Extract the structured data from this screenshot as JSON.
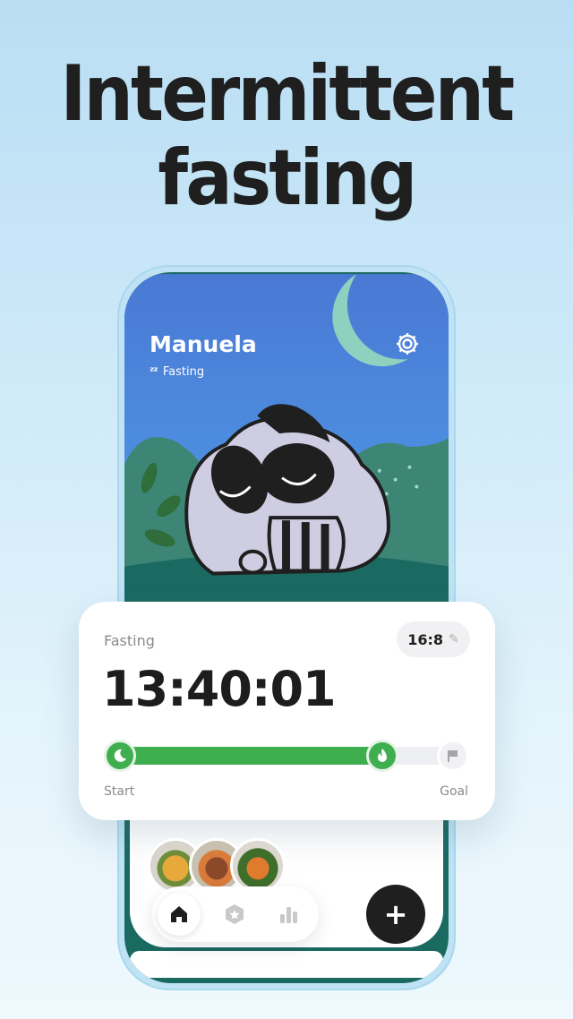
{
  "headline": {
    "line1": "Intermittent",
    "line2": "fasting"
  },
  "profile": {
    "name": "Manuela",
    "status": "Fasting",
    "status_icon": "zz",
    "settings_icon": "gear-icon"
  },
  "fasting_card": {
    "label": "Fasting",
    "plan": "16:8",
    "timer": "13:40:01",
    "progress": 0.75,
    "start_label": "Start",
    "goal_label": "Goal"
  },
  "nav": {
    "home_icon": "home-icon",
    "challenges_icon": "badge-icon",
    "stats_icon": "stats-icon",
    "add_label": "+"
  },
  "colors": {
    "accent_green": "#3fae4f",
    "sky_top": "#4a7dd6",
    "sky_bottom": "#4e9ee8",
    "moon": "#8fd1bf",
    "grass": "#1b6a62",
    "fab": "#1f1f1f"
  }
}
